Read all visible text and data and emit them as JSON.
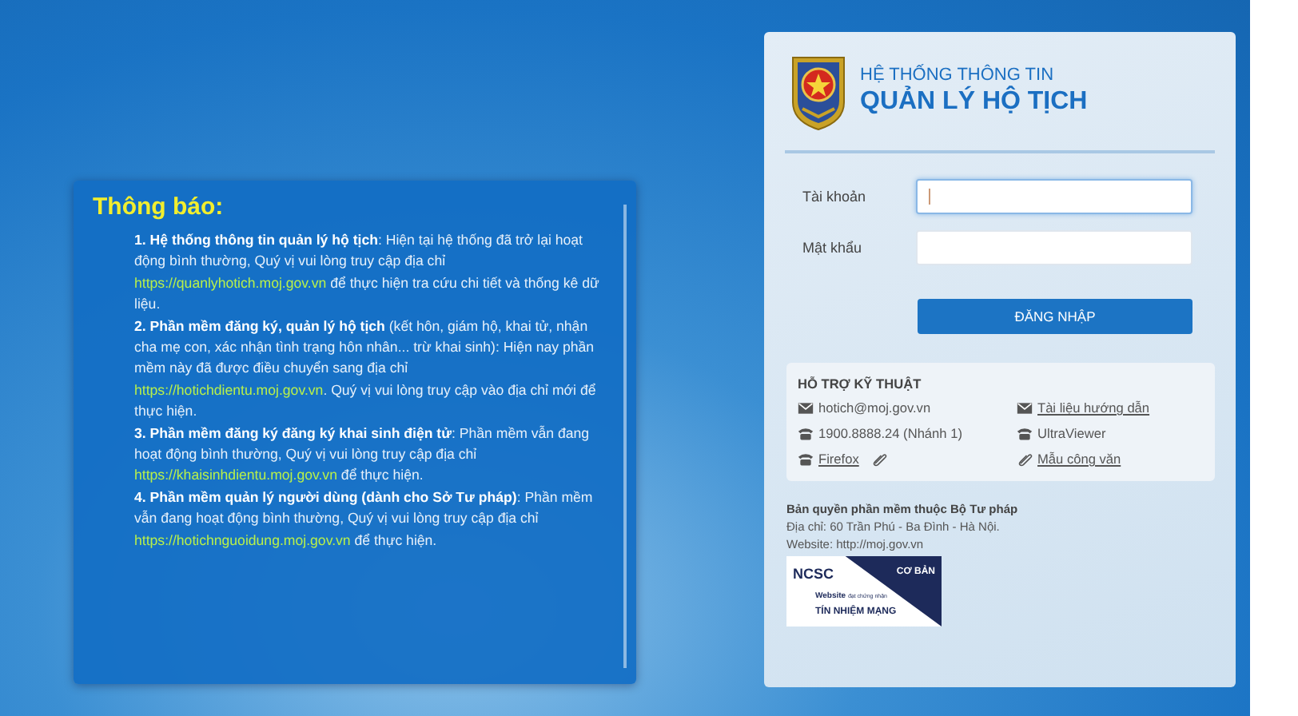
{
  "notice": {
    "title": "Thông báo:",
    "items": [
      {
        "segments": [
          {
            "kind": "bold",
            "text": "1. Hệ thống thông tin quản lý hộ tịch"
          },
          {
            "kind": "text",
            "text": ": Hiện tại hệ thống đã trở lại hoạt động bình thường, Quý vị vui lòng truy cập địa chỉ "
          },
          {
            "kind": "link",
            "text": "https://quanlyhotich.moj.gov.vn"
          },
          {
            "kind": "text",
            "text": " để thực hiện tra cứu chi tiết và thống kê dữ liệu."
          }
        ]
      },
      {
        "segments": [
          {
            "kind": "bold",
            "text": "2. Phần mềm đăng ký, quản lý hộ tịch"
          },
          {
            "kind": "text",
            "text": " (kết hôn, giám hộ, khai tử, nhận cha mẹ con, xác nhận tình trạng hôn nhân... trừ khai sinh): Hiện nay phần mềm này đã được điều chuyển sang địa chỉ "
          },
          {
            "kind": "link",
            "text": "https://hotichdientu.moj.gov.vn"
          },
          {
            "kind": "text",
            "text": ". Quý vị vui lòng truy cập vào địa chỉ mới để thực hiện."
          }
        ]
      },
      {
        "segments": [
          {
            "kind": "bold",
            "text": "3. Phần mềm đăng ký đăng ký khai sinh điện tử"
          },
          {
            "kind": "text",
            "text": ": Phần mềm vẫn đang hoạt động bình thường, Quý vị vui lòng truy cập địa chỉ "
          },
          {
            "kind": "link",
            "text": "https://khaisinhdientu.moj.gov.vn"
          },
          {
            "kind": "text",
            "text": " để thực hiện."
          }
        ]
      },
      {
        "segments": [
          {
            "kind": "bold",
            "text": "4. Phần mềm quản lý người dùng (dành cho Sở Tư pháp)"
          },
          {
            "kind": "text",
            "text": ": Phần mềm vẫn đang hoạt động bình thường, Quý vị vui lòng truy cập địa chỉ "
          },
          {
            "kind": "link",
            "text": "https://hotichnguoidung.moj.gov.vn"
          },
          {
            "kind": "text",
            "text": " để thực hiện."
          }
        ]
      }
    ]
  },
  "login": {
    "brand": {
      "line1": "HỆ THỐNG THÔNG TIN",
      "line2": "QUẢN LÝ HỘ TỊCH"
    },
    "fields": [
      {
        "label": "Tài khoản",
        "focused": true
      },
      {
        "label": "Mật khẩu",
        "focused": false
      }
    ],
    "submit": "ĐĂNG NHẬP",
    "support": {
      "title": "HỖ TRỢ KỸ THUẬT",
      "items": [
        {
          "kind": "email",
          "text": "hotich@moj.gov.vn",
          "link": false,
          "attachment": false
        },
        {
          "kind": "email",
          "text": "Tài liệu hướng dẫn",
          "link": true,
          "attachment": false
        },
        {
          "kind": "phone",
          "text": "1900.8888.24 (Nhánh 1)",
          "link": false,
          "attachment": false
        },
        {
          "kind": "phone",
          "text": "UltraViewer",
          "link": false,
          "attachment": false
        },
        {
          "kind": "phone",
          "text": "Firefox",
          "link": true,
          "attachment": true
        },
        {
          "kind": "file",
          "text": "Mẫu công văn",
          "link": true,
          "attachment": false
        }
      ]
    },
    "footer": {
      "owner": "Bản quyền phần mềm thuộc Bộ Tư pháp",
      "address": "Địa chỉ: 60 Trần Phú - Ba Đình - Hà Nội.",
      "website": "Website: http://moj.gov.vn"
    },
    "badge": {
      "brand": "NCSC",
      "level": "CƠ BẢN",
      "line1": "Website",
      "line1_small": "đạt chứng nhận",
      "line2": "TÍN NHIỆM MẠNG"
    }
  }
}
